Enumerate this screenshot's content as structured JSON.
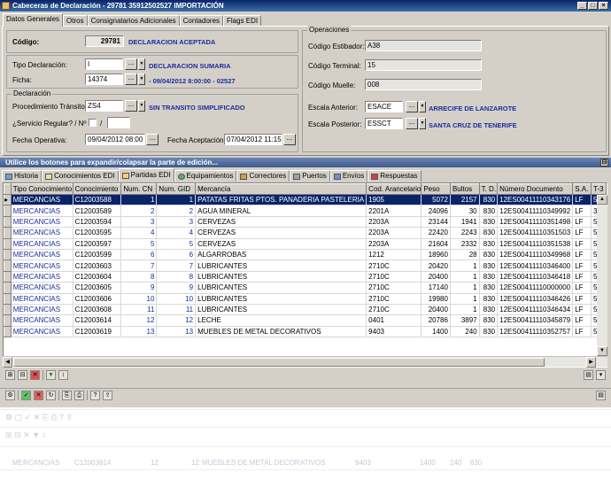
{
  "window": {
    "title": "Cabeceras de Declaración - 29781  35912502527 IMPORTACIÓN",
    "min": "_",
    "max": "□",
    "close": "×"
  },
  "top_tabs": [
    "Datos Generales",
    "Otros",
    "Consignatarios Adicionales",
    "Contadores",
    "Flags EDI"
  ],
  "codigo": {
    "label": "Código:",
    "value": "29781",
    "status": "DECLARACION ACEPTADA"
  },
  "tipo": {
    "label": "Tipo Declaración:",
    "value": "I",
    "desc": "DECLARACION SUMARIA"
  },
  "ficha": {
    "label": "Ficha:",
    "value": "14374",
    "desc": "- 09/04/2012 8:00:00 - 02527"
  },
  "declaracion": {
    "group": "Declaración",
    "proc_label": "Procedimiento Tránsito:",
    "proc_value": "ZS4",
    "proc_desc": "SIN TRANSITO SIMPLIFICADO",
    "servicio_label": "¿Servicio Regular? / Nº",
    "slash": "/",
    "fop_label": "Fecha Operativa:",
    "fop_value": "09/04/2012 08:00",
    "facep_label": "Fecha Aceptación:",
    "facep_value": "07/04/2012 11:15"
  },
  "operaciones": {
    "group": "Operaciones",
    "estibador_label": "Código Estibador:",
    "estibador_value": "A38",
    "terminal_label": "Código Terminal:",
    "terminal_value": "15",
    "muelle_label": "Código Muelle:",
    "muelle_value": "008",
    "esc_ant_label": "Escala Anterior:",
    "esc_ant_value": "ESACE",
    "esc_ant_desc": "ARRECIFE DE LANZAROTE",
    "esc_post_label": "Escala Posterior:",
    "esc_post_value": "ESSCT",
    "esc_post_desc": "SANTA CRUZ DE TENERIFE"
  },
  "expand_bar": "Utilice los botones para expandir/colapsar la parte de edición...",
  "bottom_tabs": [
    "Historia",
    "Conocimientos EDI",
    "Partidas EDI",
    "Equipamientos",
    "Correctores",
    "Puertos",
    "Envíos",
    "Respuestas"
  ],
  "grid": {
    "columns": [
      "Tipo Conocimiento",
      "Conocimiento",
      "Num. CN",
      "Num. GID",
      "Mercancía",
      "Cod. Arancelario",
      "Peso",
      "Bultos",
      "T. D.",
      "Número Documento",
      "S.A.",
      "T-3"
    ],
    "rows": [
      [
        "MERCANCIAS",
        "C12003588",
        "1",
        "1",
        "PATATAS FRITAS PTOS. PANADERIA PASTELERIA",
        "1905",
        "5072",
        "2157",
        "830",
        "12ES00411110343176",
        "LF",
        "5"
      ],
      [
        "MERCANCIAS",
        "C12003589",
        "2",
        "2",
        "AGUA MINERAL",
        "2201A",
        "24096",
        "30",
        "830",
        "12ES00411110349992",
        "LF",
        "3"
      ],
      [
        "MERCANCIAS",
        "C12003594",
        "3",
        "3",
        "CERVEZAS",
        "2203A",
        "23144",
        "1941",
        "830",
        "12ES00411110351498",
        "LF",
        "5"
      ],
      [
        "MERCANCIAS",
        "C12003595",
        "4",
        "4",
        "CERVEZAS",
        "2203A",
        "22420",
        "2243",
        "830",
        "12ES00411110351503",
        "LF",
        "5"
      ],
      [
        "MERCANCIAS",
        "C12003597",
        "5",
        "5",
        "CERVEZAS",
        "2203A",
        "21604",
        "2332",
        "830",
        "12ES00411110351538",
        "LF",
        "5"
      ],
      [
        "MERCANCIAS",
        "C12003599",
        "6",
        "6",
        "ALGARROBAS",
        "1212",
        "18960",
        "28",
        "830",
        "12ES00411110349968",
        "LF",
        "5"
      ],
      [
        "MERCANCIAS",
        "C12003603",
        "7",
        "7",
        "LUBRICANTES",
        "2710C",
        "20420",
        "1",
        "830",
        "12ES00411110346400",
        "LF",
        "5"
      ],
      [
        "MERCANCIAS",
        "C12003604",
        "8",
        "8",
        "LUBRICANTES",
        "2710C",
        "20400",
        "1",
        "830",
        "12ES00411110346418",
        "LF",
        "5"
      ],
      [
        "MERCANCIAS",
        "C12003605",
        "9",
        "9",
        "LUBRICANTES",
        "2710C",
        "17140",
        "1",
        "830",
        "12ES00411110000000",
        "LF",
        "5"
      ],
      [
        "MERCANCIAS",
        "C12003606",
        "10",
        "10",
        "LUBRICANTES",
        "2710C",
        "19980",
        "1",
        "830",
        "12ES00411110346426",
        "LF",
        "5"
      ],
      [
        "MERCANCIAS",
        "C12003608",
        "11",
        "11",
        "LUBRICANTES",
        "2710C",
        "20400",
        "1",
        "830",
        "12ES00411110346434",
        "LF",
        "5"
      ],
      [
        "MERCANCIAS",
        "C12003614",
        "12",
        "12",
        "LECHE",
        "0401",
        "20786",
        "3897",
        "830",
        "12ES00411110345879",
        "LF",
        "5"
      ],
      [
        "MERCANCIAS",
        "C12003619",
        "13",
        "13",
        "MUEBLES DE METAL DECORATIVOS",
        "9403",
        "1400",
        "240",
        "830",
        "12ES00411110352757",
        "LF",
        "5"
      ]
    ]
  },
  "ghost": {
    "row_a": [
      "MERCANCIAS",
      "C12003614",
      "12",
      "12",
      "MUEBLES DE METAL DECORATIVOS",
      "9403",
      "1400",
      "240",
      "830"
    ]
  },
  "colors": {
    "title": "#0a246a",
    "accent_blue": "#1c2c9c",
    "selection": "#0a246a",
    "panel": "#d4d0c8"
  }
}
